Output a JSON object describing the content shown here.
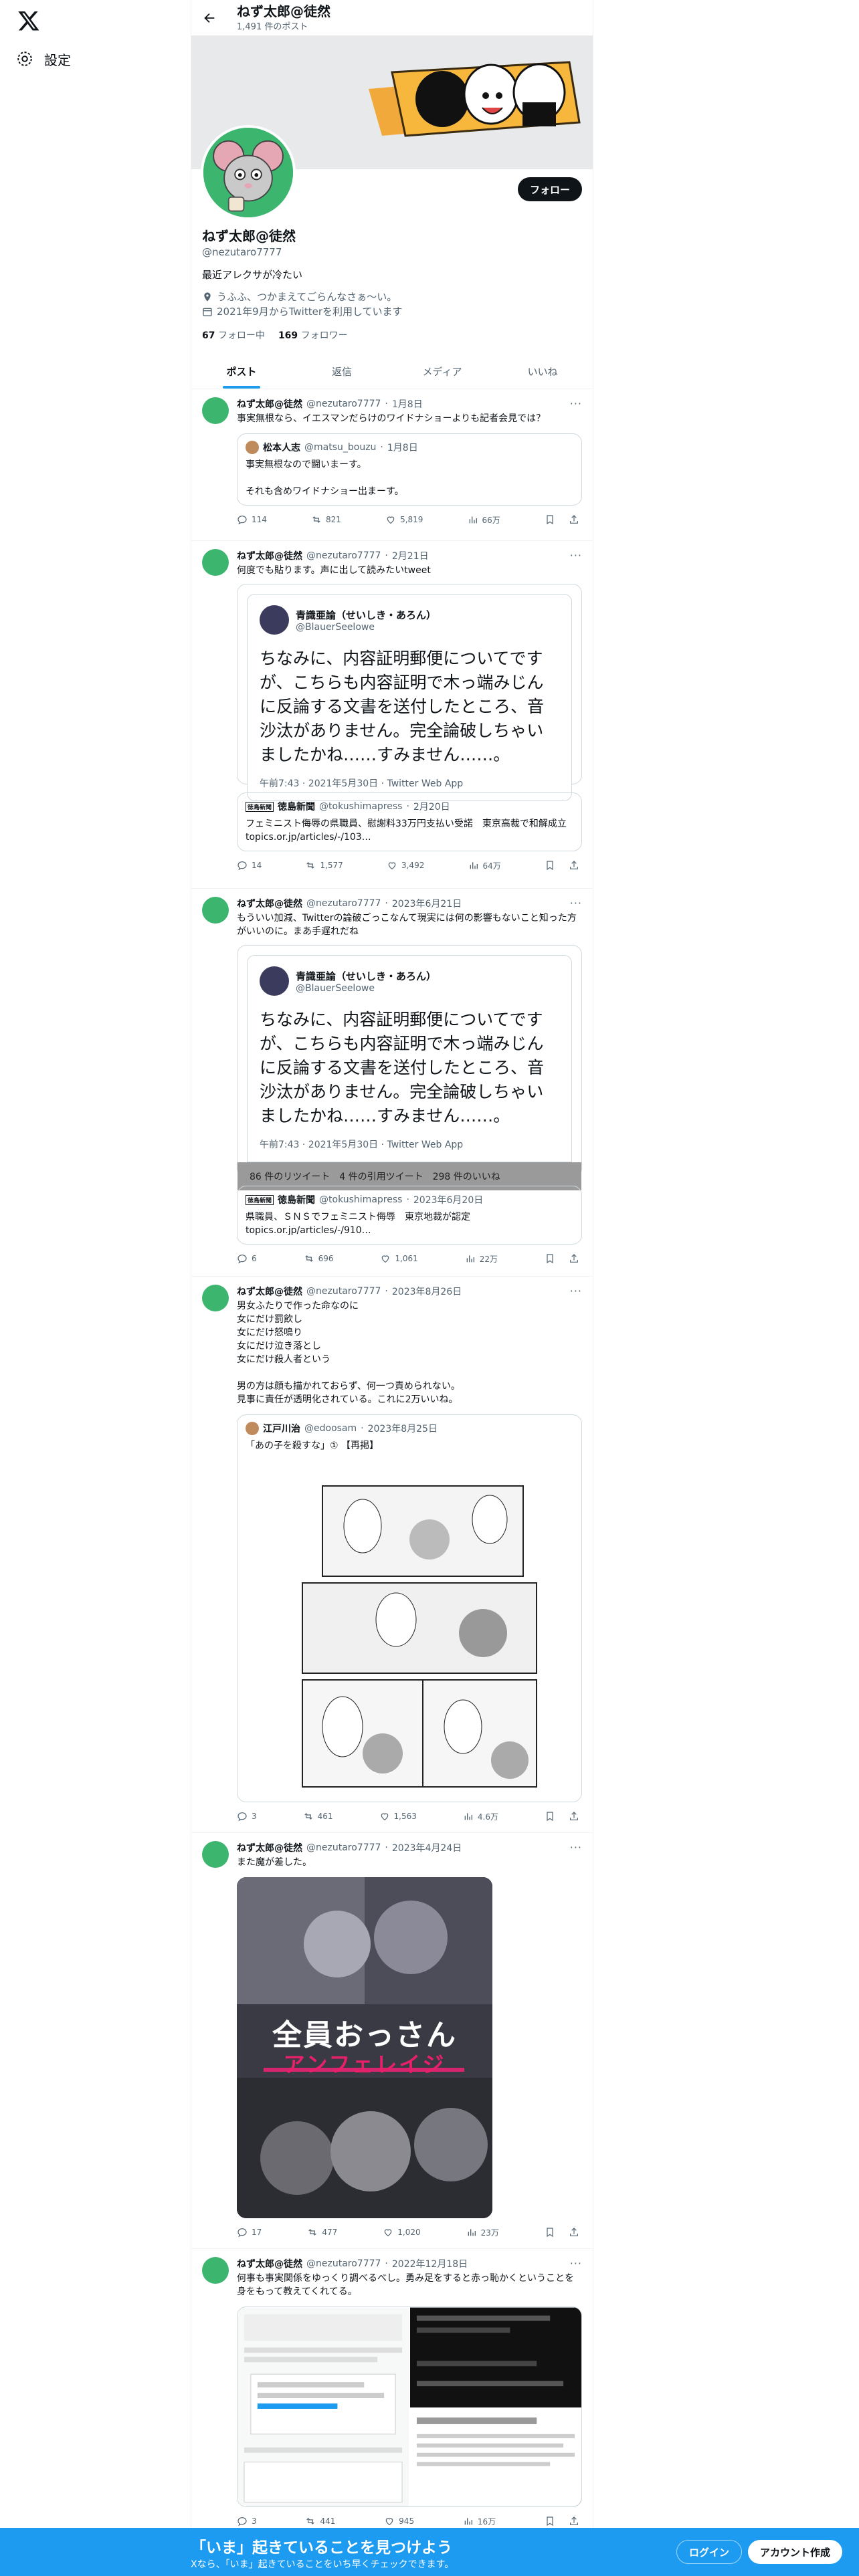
{
  "nav": {
    "settings_label": "設定"
  },
  "header": {
    "name": "ねず太郎@徒然",
    "post_count": "1,491 件のポスト"
  },
  "profile": {
    "name": "ねず太郎@徒然",
    "handle": "@nezutaro7777",
    "follow_label": "フォロー",
    "bio": "最近アレクサが冷たい",
    "location": "うふふ、つかまえてごらんなさぁ～い。",
    "joined": "2021年9月からTwitterを利用しています",
    "following_count": "67",
    "following_label": "フォロー中",
    "followers_count": "169",
    "followers_label": "フォロワー"
  },
  "tabs": [
    {
      "label": "ポスト"
    },
    {
      "label": "返信"
    },
    {
      "label": "メディア"
    },
    {
      "label": "いいね"
    }
  ],
  "tweets": [
    {
      "name": "ねず太郎@徒然",
      "handle": "@nezutaro7777",
      "date": "1月8日",
      "text": "事実無根なら、イエスマンだらけのワイドナショーよりも記者会見では？",
      "quote": {
        "name": "松本人志",
        "handle": "@matsu_bouzu",
        "date": "1月8日",
        "text": "事実無根なので闘いまーす。\n\nそれも含めワイドナショー出まーす。"
      },
      "replies": "114",
      "retweets": "821",
      "likes": "5,819",
      "views": "66万"
    },
    {
      "name": "ねず太郎@徒然",
      "handle": "@nezutaro7777",
      "date": "2月21日",
      "text": "何度でも貼ります。声に出して読みたいtweet",
      "embed": {
        "name": "青識亜論（せいしき・あろん）",
        "handle": "@BlauerSeelowe",
        "text": "ちなみに、内容証明郵便についてですが、こちらも内容証明で木っ端みじんに反論する文書を送付したところ、音沙汰がありません。完全論破しちゃいましたかね……すみません……。",
        "time": "午前7:43 · 2021年5月30日 · Twitter Web App"
      },
      "news": {
        "logo": "徳島新聞",
        "name": "徳島新聞",
        "handle": "@tokushimapress",
        "date": "2月20日",
        "text": "フェミニスト侮辱の県職員、慰謝料33万円支払い受諾　東京高裁で和解成立 topics.or.jp/articles/-/103…"
      },
      "replies": "14",
      "retweets": "1,577",
      "likes": "3,492",
      "views": "64万"
    },
    {
      "name": "ねず太郎@徒然",
      "handle": "@nezutaro7777",
      "date": "2023年6月21日",
      "text": "もういい加減、Twitterの論破ごっこなんて現実には何の影響もないこと知った方がいいのに。まあ手遅れだね",
      "embed": {
        "name": "青識亜論（せいしき・あろん）",
        "handle": "@BlauerSeelowe",
        "text": "ちなみに、内容証明郵便についてですが、こちらも内容証明で木っ端みじんに反論する文書を送付したところ、音沙汰がありません。完全論破しちゃいましたかね……すみません……。",
        "time": "午前7:43 · 2021年5月30日 · Twitter Web App",
        "stats": "86 件のリツイート　4 件の引用ツイート　298 件のいいね"
      },
      "news": {
        "logo": "徳島新聞",
        "name": "徳島新聞",
        "handle": "@tokushimapress",
        "date": "2023年6月20日",
        "text": "県職員、ＳＮＳでフェミニスト侮辱　東京地裁が認定 topics.or.jp/articles/-/910…"
      },
      "replies": "6",
      "retweets": "696",
      "likes": "1,061",
      "views": "22万"
    },
    {
      "name": "ねず太郎@徒然",
      "handle": "@nezutaro7777",
      "date": "2023年8月26日",
      "text": "男女ふたりで作った命なのに\n女にだけ罰飲し\n女にだけ怒鳴り\n女にだけ泣き落とし\n女にだけ殺人者という\n\n男の方は顔も描かれておらず、何一つ責められない。\n見事に責任が透明化されている。これに2万いいね。",
      "quote": {
        "name": "江戸川治",
        "handle": "@edoosam",
        "date": "2023年8月25日",
        "text": "「あの子を殺すな」① 【再掲】"
      },
      "replies": "3",
      "retweets": "461",
      "likes": "1,563",
      "views": "4.6万"
    },
    {
      "name": "ねず太郎@徒然",
      "handle": "@nezutaro7777",
      "date": "2023年4月24日",
      "text": "また魔が差した。",
      "image_title": "全員おっさん",
      "image_sub": "アンフェレイジ",
      "replies": "17",
      "retweets": "477",
      "likes": "1,020",
      "views": "23万"
    },
    {
      "name": "ねず太郎@徒然",
      "handle": "@nezutaro7777",
      "date": "2022年12月18日",
      "text": "何事も事実関係をゆっくり調べるべし。勇み足をすると赤っ恥かくということを身をもって教えてくれてる。",
      "replies": "3",
      "retweets": "441",
      "likes": "945",
      "views": "16万"
    }
  ],
  "bottom": {
    "title": "「いま」起きていることを見つけよう",
    "subtitle": "Xなら、「いま」起きていることをいち早くチェックできます。",
    "login": "ログイン",
    "signup": "アカウント作成"
  }
}
